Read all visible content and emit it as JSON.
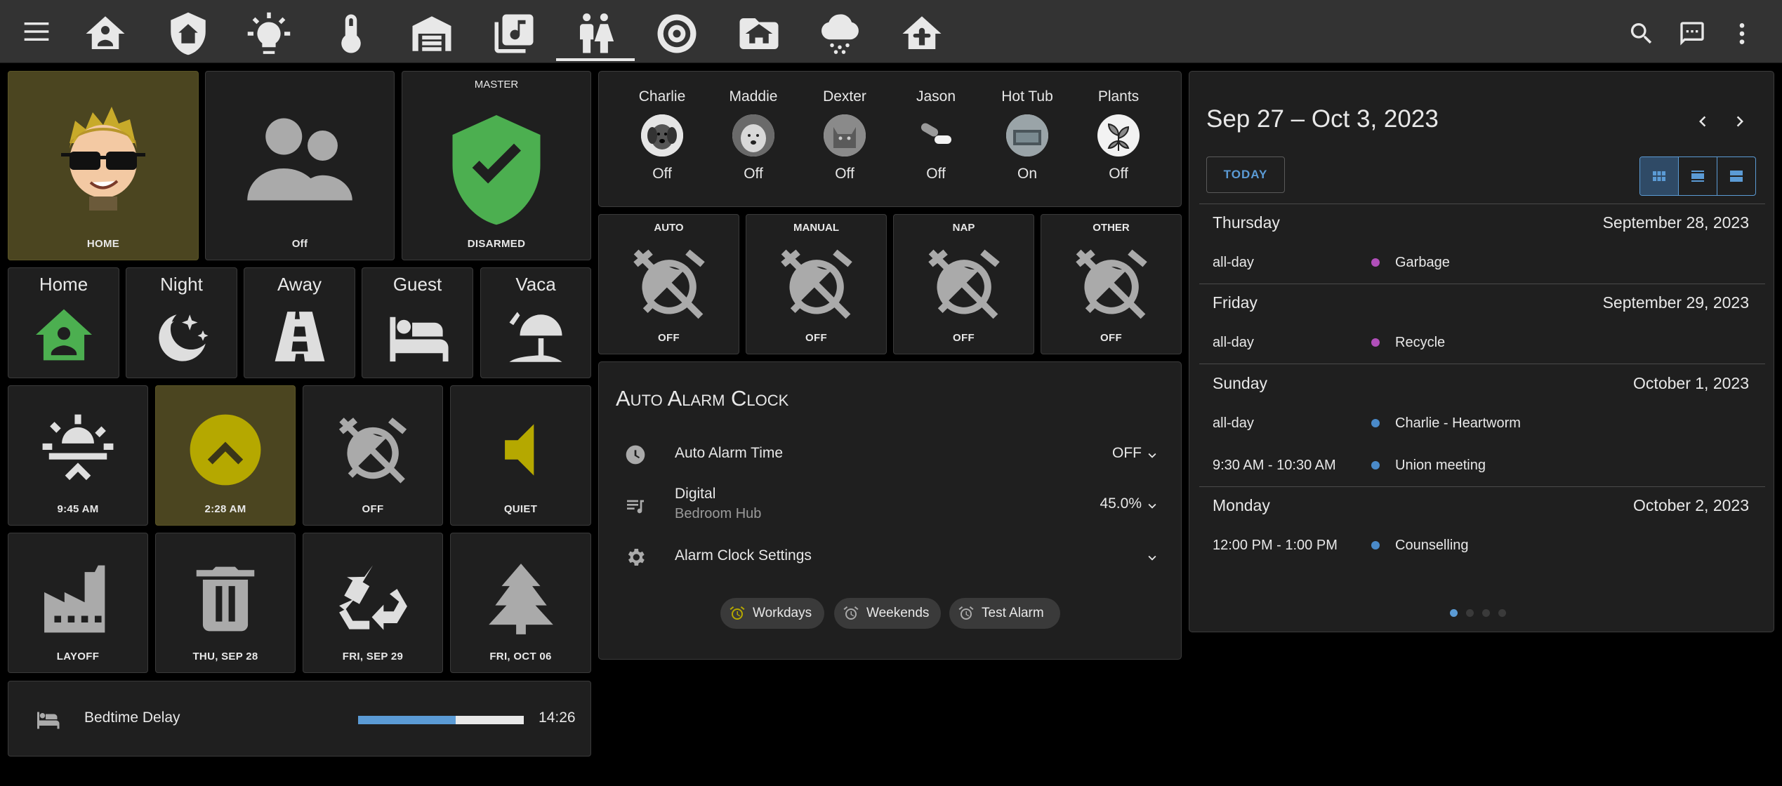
{
  "topbar": {
    "icons": [
      "menu-icon",
      "home-account-icon",
      "shield-home-icon",
      "ceiling-light-icon",
      "thermometer-icon",
      "garage-icon",
      "music-box-multiple-icon",
      "human-male-female-icon",
      "speaker-icon",
      "folder-home-icon",
      "weather-snowy-icon",
      "home-automation-icon"
    ],
    "right_icons": [
      "search-icon",
      "chat-icon",
      "dots-vertical-icon"
    ]
  },
  "left": {
    "home_tile_label": "HOME",
    "people_tile_label": "Off",
    "alarm_tile": {
      "top": "MASTER",
      "label": "DISARMED"
    },
    "modes": [
      "Home",
      "Night",
      "Away",
      "Guest",
      "Vaca"
    ],
    "row3": [
      "9:45 AM",
      "2:28 AM",
      "OFF",
      "QUIET"
    ],
    "row4": [
      "LAYOFF",
      "THU, SEP 28",
      "FRI, SEP 29",
      "FRI, OCT 06"
    ],
    "bedtime": {
      "label": "Bedtime Delay",
      "value": "14:26",
      "progress": 0.59
    }
  },
  "middle": {
    "people": [
      {
        "name": "Charlie",
        "state": "Off"
      },
      {
        "name": "Maddie",
        "state": "Off"
      },
      {
        "name": "Dexter",
        "state": "Off"
      },
      {
        "name": "Jason",
        "state": "Off"
      },
      {
        "name": "Hot Tub",
        "state": "On"
      },
      {
        "name": "Plants",
        "state": "Off"
      }
    ],
    "alarms": [
      {
        "top": "AUTO",
        "label": "OFF"
      },
      {
        "top": "MANUAL",
        "label": "OFF"
      },
      {
        "top": "NAP",
        "label": "OFF"
      },
      {
        "top": "OTHER",
        "label": "OFF"
      }
    ],
    "auto_alarm": {
      "title": "Auto Alarm Clock",
      "rows": [
        {
          "label": "Auto Alarm Time",
          "value": "OFF"
        },
        {
          "label": "Digital",
          "sub": "Bedroom Hub",
          "value": "45.0%"
        },
        {
          "label": "Alarm Clock Settings",
          "value": ""
        }
      ],
      "chips": [
        "Workdays",
        "Weekends",
        "Test Alarm"
      ]
    }
  },
  "calendar": {
    "title": "Sep 27 – Oct 3, 2023",
    "today": "TODAY",
    "days": [
      {
        "day": "Thursday",
        "date": "September 28, 2023",
        "events": [
          {
            "time": "all-day",
            "name": "Garbage",
            "color": "#b04fb9"
          }
        ]
      },
      {
        "day": "Friday",
        "date": "September 29, 2023",
        "events": [
          {
            "time": "all-day",
            "name": "Recycle",
            "color": "#b04fb9"
          }
        ]
      },
      {
        "day": "Sunday",
        "date": "October 1, 2023",
        "events": [
          {
            "time": "all-day",
            "name": "Charlie - Heartworm",
            "color": "#4a8ac9"
          },
          {
            "time": "9:30 AM - 10:30 AM",
            "name": "Union meeting",
            "color": "#4a8ac9"
          }
        ]
      },
      {
        "day": "Monday",
        "date": "October 2, 2023",
        "events": [
          {
            "time": "12:00 PM - 1:00 PM",
            "name": "Counselling",
            "color": "#4a8ac9"
          }
        ]
      }
    ]
  },
  "colors": {
    "accent_green": "#4caf50",
    "accent_yellow": "#b5a800",
    "accent_blue": "#5b9bd5",
    "tile_yellow_bg": "#4b4520"
  }
}
